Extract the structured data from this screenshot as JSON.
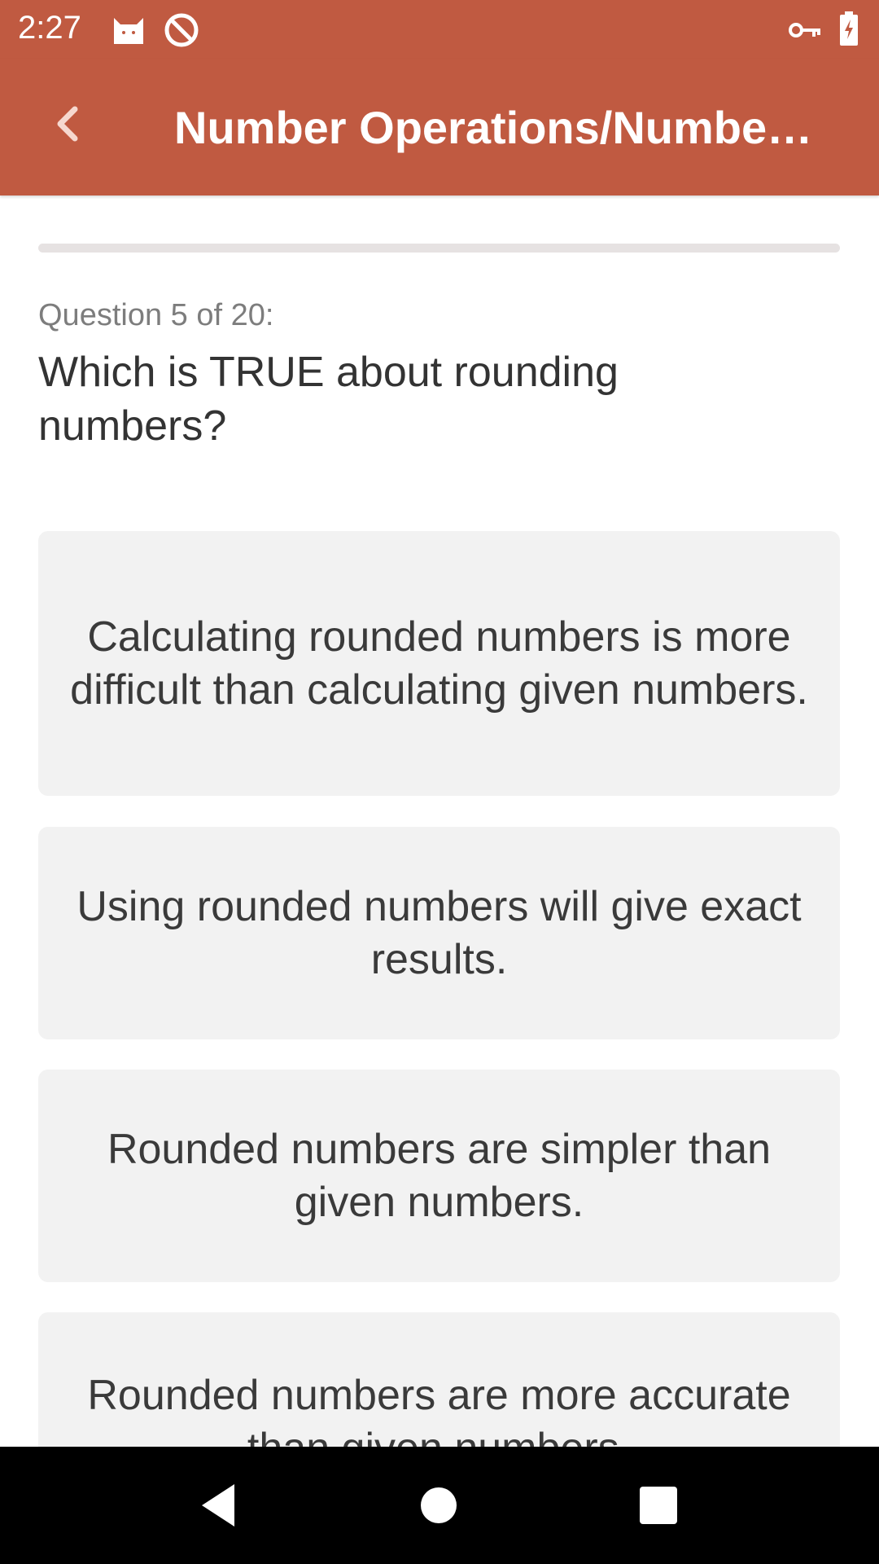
{
  "status_bar": {
    "time": "2:27",
    "icons": [
      "cat-icon",
      "do-not-disturb-icon",
      "vpn-key-icon",
      "battery-charging-icon"
    ]
  },
  "app_bar": {
    "title": "Number Operations/Numbe…",
    "back_icon": "chevron-left-icon",
    "color": "#c05a41"
  },
  "quiz": {
    "question_label": "Question 5 of 20:",
    "question": "Which is TRUE about rounding numbers?",
    "progress": 0.0,
    "answers": [
      "Calculating rounded numbers is more difficult than calculating given numbers.",
      "Using rounded numbers will give exact results.",
      "Rounded numbers are simpler than given numbers.",
      "Rounded numbers are more accurate than given numbers."
    ]
  },
  "nav_bar": {
    "icons": [
      "back-triangle-icon",
      "home-circle-icon",
      "recents-square-icon"
    ]
  }
}
